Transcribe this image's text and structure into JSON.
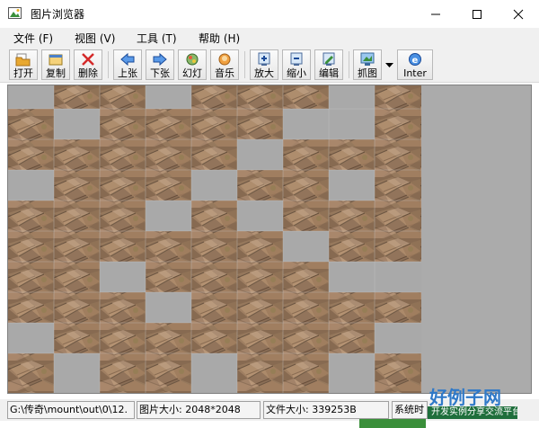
{
  "window": {
    "title": "图片浏览器",
    "controls": [
      "minimize-icon",
      "maximize-icon",
      "close-icon"
    ]
  },
  "menu": {
    "items": [
      {
        "label": "文件 (F)"
      },
      {
        "label": "视图 (V)"
      },
      {
        "label": "工具 (T)"
      },
      {
        "label": "帮助 (H)"
      }
    ]
  },
  "toolbar": {
    "buttons": [
      {
        "label": "打开",
        "icon": "open-folder-icon"
      },
      {
        "label": "复制",
        "icon": "copy-icon"
      },
      {
        "label": "删除",
        "icon": "delete-x-icon"
      },
      {
        "label": "上张",
        "icon": "arrow-left-icon"
      },
      {
        "label": "下张",
        "icon": "arrow-right-icon"
      },
      {
        "label": "幻灯",
        "icon": "slideshow-icon"
      },
      {
        "label": "音乐",
        "icon": "music-icon"
      },
      {
        "label": "放大",
        "icon": "zoom-in-icon"
      },
      {
        "label": "缩小",
        "icon": "zoom-out-icon"
      },
      {
        "label": "编辑",
        "icon": "edit-icon"
      },
      {
        "label": "抓图",
        "icon": "capture-icon"
      },
      {
        "label": "Inter",
        "icon": "internet-icon"
      }
    ]
  },
  "status": {
    "path": "G:\\传奇\\mount\\out\\0\\12.",
    "image_size": "图片大小: 2048*2048",
    "file_size": "文件大小: 339253B",
    "system_time": "系统时"
  },
  "overlay": {
    "watermark": "好例子网",
    "tagline": "开发实例分享交流平台"
  },
  "colors": {
    "viewer_bg": "#ababab",
    "tile_stone": "#9a7a5a",
    "delete_red": "#d42a2a",
    "arrow_blue": "#2a6fd4"
  }
}
